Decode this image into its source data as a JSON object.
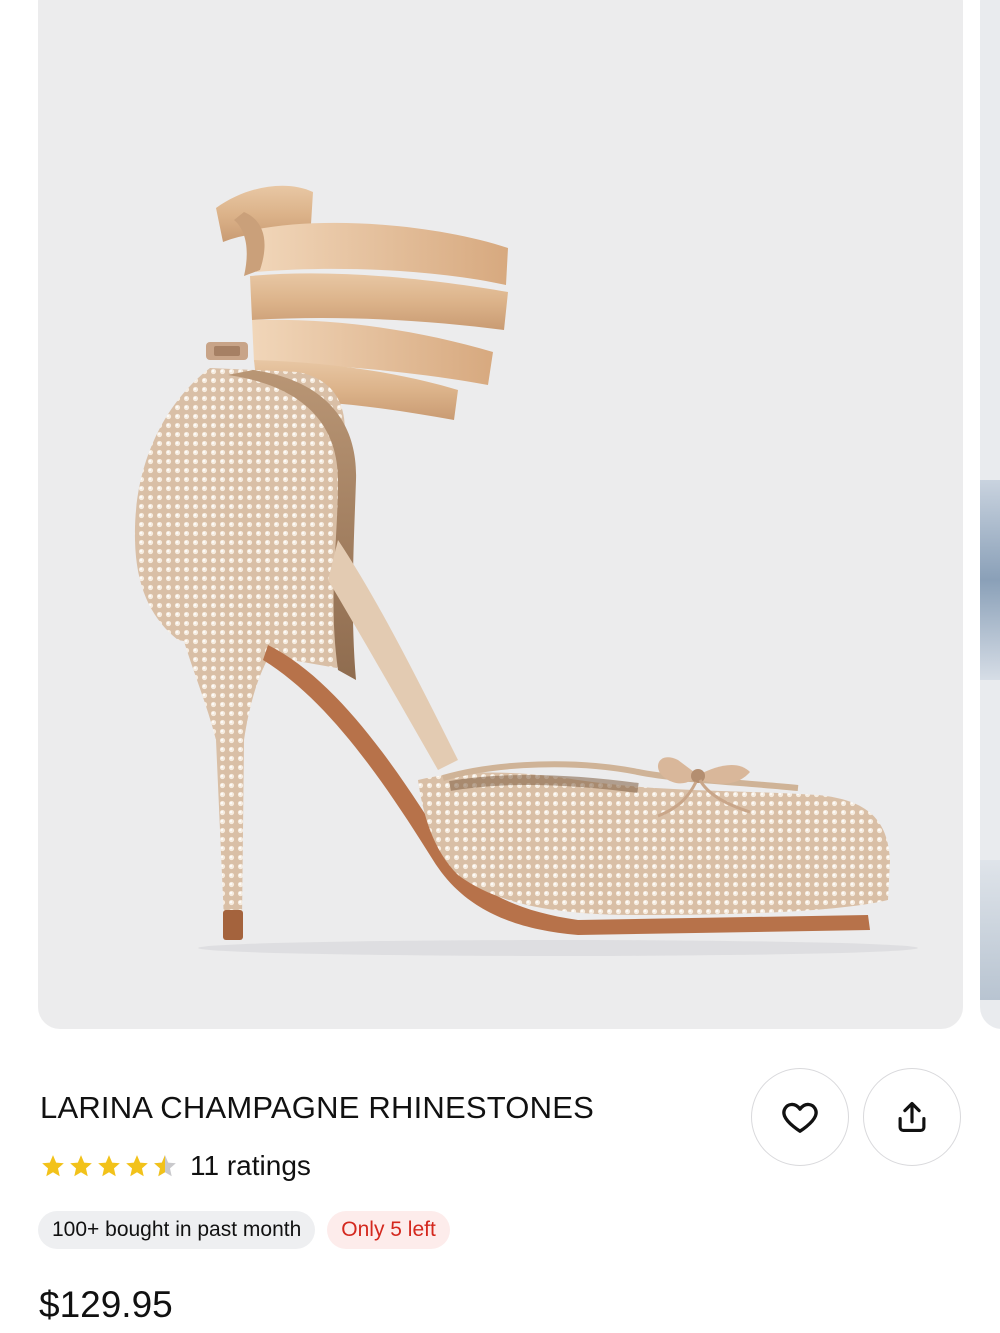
{
  "product": {
    "title": "LARINA CHAMPAGNE RHINESTONES",
    "rating": 4.5,
    "rating_max": 5,
    "ratings_label": "11 ratings",
    "badges": {
      "bought": "100+ bought in past month",
      "stock": "Only 5 left"
    },
    "price": "$129.95"
  },
  "actions": {
    "favorite_icon": "heart-icon",
    "share_icon": "share-icon"
  },
  "colors": {
    "star": "#f2c21a",
    "star_empty": "#c9c9cc",
    "stock_text": "#d4281e",
    "stock_bg": "#fdeceb",
    "image_bg": "#ececed"
  }
}
